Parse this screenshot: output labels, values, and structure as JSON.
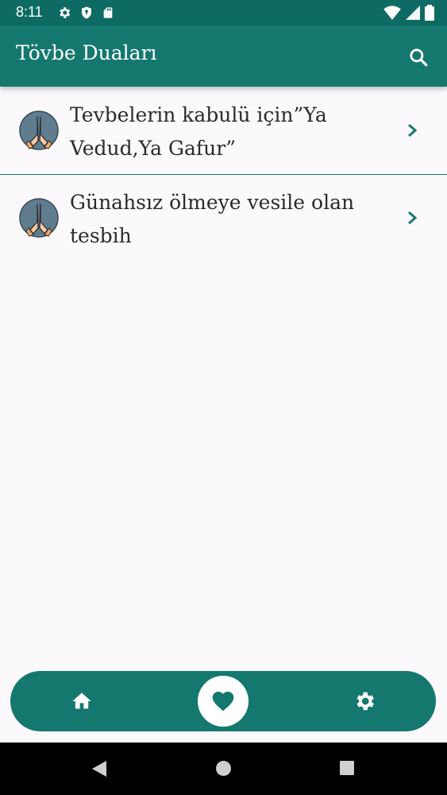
{
  "status": {
    "time": "8:11"
  },
  "appbar": {
    "title": "Tövbe Duaları",
    "search_icon": "search-icon"
  },
  "list": {
    "items": [
      {
        "label": "Tevbelerin kabulü için”Ya Vedud,Ya Gafur”",
        "icon": "praying-hands-icon"
      },
      {
        "label": "Günahsız ölmeye vesile olan tesbih",
        "icon": "praying-hands-icon"
      }
    ]
  },
  "bottom_nav": {
    "items": [
      "home-icon",
      "heart-icon",
      "settings-icon"
    ],
    "active": "heart-icon"
  },
  "colors": {
    "primary": "#15786f",
    "status_bar": "#0d6b63",
    "background": "#fbf9fb"
  }
}
